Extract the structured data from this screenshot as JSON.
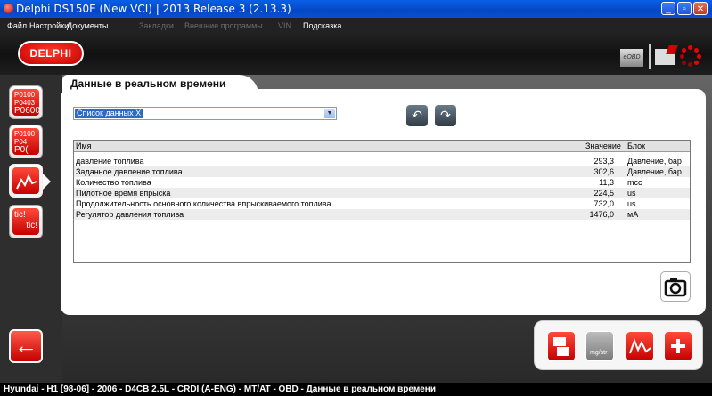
{
  "window": {
    "title": "Delphi DS150E (New VCI) | 2013 Release 3 (2.13.3)"
  },
  "menu": {
    "file": "Файл",
    "settings": "Настройки",
    "documents": "Документы",
    "bookmarks": "Закладки",
    "external": "Внешние программы",
    "vin": "VIN",
    "help": "Подсказка"
  },
  "header": {
    "logo": "DELPHI",
    "eobd": "eOBD"
  },
  "sidebar": {
    "icon1": [
      "P0100",
      "P0403",
      "P0600"
    ],
    "icon2": [
      "P0100",
      "P04",
      "P0("
    ],
    "icon4": [
      "tic!",
      "tic!"
    ]
  },
  "page": {
    "title": "Данные в реальном времени"
  },
  "datalist": {
    "selected": "Список данных X"
  },
  "table": {
    "headers": {
      "name": "Имя",
      "value": "Значение",
      "unit": "Блок"
    },
    "rows": [
      {
        "name": "давление топлива",
        "value": "293,3",
        "unit": "Давление, бар"
      },
      {
        "name": "Заданное давление топлива",
        "value": "302,6",
        "unit": "Давление, бар"
      },
      {
        "name": "Количество топлива",
        "value": "11,3",
        "unit": "mcc"
      },
      {
        "name": "Пилотное время впрыска",
        "value": "224,5",
        "unit": "us"
      },
      {
        "name": "Продолжительность основного количества впрыскиваемого топлива",
        "value": "732,0",
        "unit": "us"
      },
      {
        "name": "Регулятор давления топлива",
        "value": "1476,0",
        "unit": "мА"
      }
    ]
  },
  "toolbar": {
    "gauge_label": "mg/str"
  },
  "status": {
    "text": "Hyundai - H1 [98-06] - 2006 - D4CB 2.5L - CRDI (A-ENG) - MT/AT - OBD - Данные в реальном времени"
  },
  "colors": {
    "accent": "#d40000",
    "titlebar": "#0a5fe6",
    "selection": "#316ac5"
  }
}
